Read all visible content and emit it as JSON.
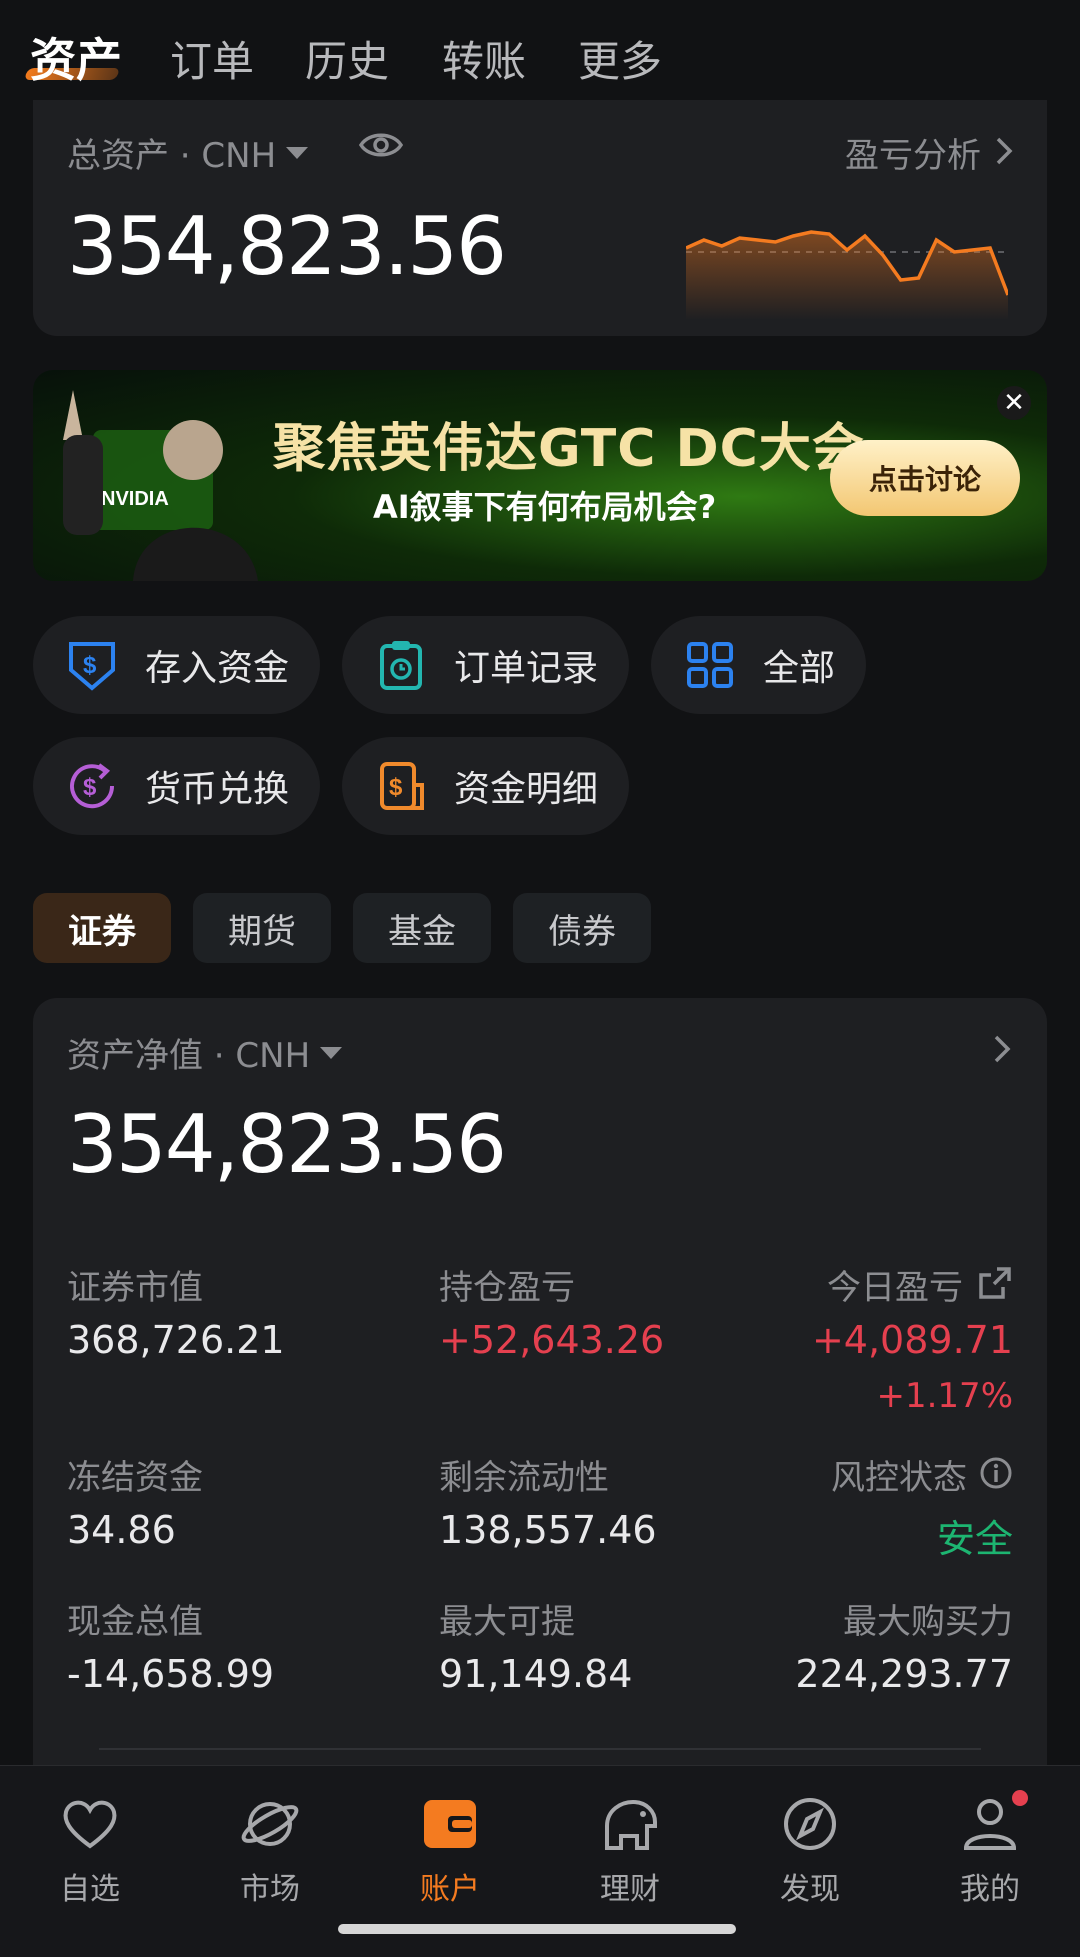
{
  "top_tabs": {
    "items": [
      {
        "label": "资产"
      },
      {
        "label": "订单"
      },
      {
        "label": "历史"
      },
      {
        "label": "转账"
      },
      {
        "label": "更多"
      }
    ],
    "active_index": 0
  },
  "total_assets": {
    "label": "总资产 · CNH",
    "value": "354,823.56",
    "analysis_link": "盈亏分析",
    "sparkline": [
      0.62,
      0.7,
      0.64,
      0.72,
      0.7,
      0.68,
      0.74,
      0.78,
      0.76,
      0.6,
      0.74,
      0.55,
      0.3,
      0.32,
      0.7,
      0.58,
      0.6,
      0.62,
      0.15
    ]
  },
  "banner": {
    "title": "聚焦英伟达GTC DC大会",
    "subtitle": "AI叙事下有何布局机会?",
    "button": "点击讨论",
    "logo_text": "NVIDIA"
  },
  "quick_actions": [
    {
      "label": "存入资金",
      "icon": "deposit-shield-icon",
      "color": "#2c82f0"
    },
    {
      "label": "订单记录",
      "icon": "clipboard-clock-icon",
      "color": "#23b6b0"
    },
    {
      "label": "全部",
      "icon": "grid-icon",
      "color": "#2c82f0"
    },
    {
      "label": "货币兑换",
      "icon": "currency-exchange-icon",
      "color": "#b55ed6"
    },
    {
      "label": "资金明细",
      "icon": "fund-detail-icon",
      "color": "#f08a2c"
    }
  ],
  "segments": [
    {
      "label": "证券"
    },
    {
      "label": "期货"
    },
    {
      "label": "基金"
    },
    {
      "label": "债券"
    }
  ],
  "net_assets": {
    "label": "资产净值 · CNH",
    "value": "354,823.56",
    "rows": [
      [
        {
          "label": "证券市值",
          "value": "368,726.21"
        },
        {
          "label": "持仓盈亏",
          "value": "+52,643.26"
        },
        {
          "label": "今日盈亏",
          "value": "+4,089.71",
          "sub": "+1.17%"
        }
      ],
      [
        {
          "label": "冻结资金",
          "value": "34.86"
        },
        {
          "label": "剩余流动性",
          "value": "138,557.46"
        },
        {
          "label": "风控状态",
          "value": "安全"
        }
      ],
      [
        {
          "label": "现金总值",
          "value": "-14,658.99"
        },
        {
          "label": "最大可提",
          "value": "91,149.84"
        },
        {
          "label": "最大购买力",
          "value": "224,293.77"
        }
      ]
    ]
  },
  "bottom_nav": [
    {
      "label": "自选",
      "icon": "heart-icon"
    },
    {
      "label": "市场",
      "icon": "planet-icon"
    },
    {
      "label": "账户",
      "icon": "wallet-icon"
    },
    {
      "label": "理财",
      "icon": "piggy-bank-icon"
    },
    {
      "label": "发现",
      "icon": "compass-icon"
    },
    {
      "label": "我的",
      "icon": "user-icon"
    }
  ],
  "colors": {
    "accent": "#f47b20",
    "up_red": "#e5404f",
    "safe_green": "#1db571",
    "background": "#111214",
    "card": "#1e1f22"
  }
}
